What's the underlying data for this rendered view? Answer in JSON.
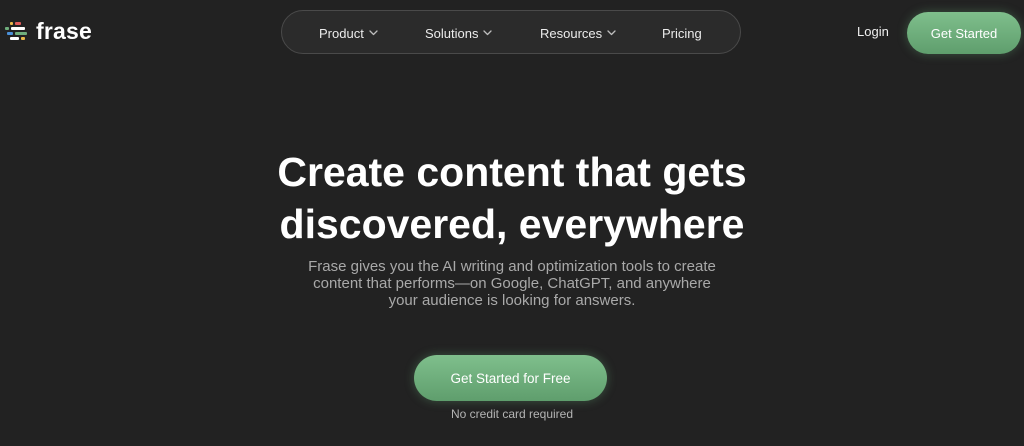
{
  "brand": {
    "name": "frase",
    "accent_color": "#6fae7c",
    "logo_bar_colors": [
      "#e9b949",
      "#e05a5a",
      "#6fae7c",
      "#4a90d9"
    ]
  },
  "nav": {
    "items": [
      {
        "label": "Product",
        "has_dropdown": true,
        "icon": "chevron-down-icon"
      },
      {
        "label": "Solutions",
        "has_dropdown": true,
        "icon": "chevron-down-icon"
      },
      {
        "label": "Resources",
        "has_dropdown": true,
        "icon": "chevron-down-icon"
      },
      {
        "label": "Pricing",
        "has_dropdown": false
      }
    ]
  },
  "header": {
    "login_label": "Login",
    "cta_label": "Get Started"
  },
  "hero": {
    "title_line1": "Create content that gets",
    "title_line2": "discovered, everywhere",
    "subtitle_line1": "Frase gives you the AI writing and optimization tools to create",
    "subtitle_line2": "content that performs—on Google, ChatGPT, and anywhere",
    "subtitle_line3": "your audience is looking for answers.",
    "cta_label": "Get Started for Free",
    "cta_note": "No credit card required"
  }
}
